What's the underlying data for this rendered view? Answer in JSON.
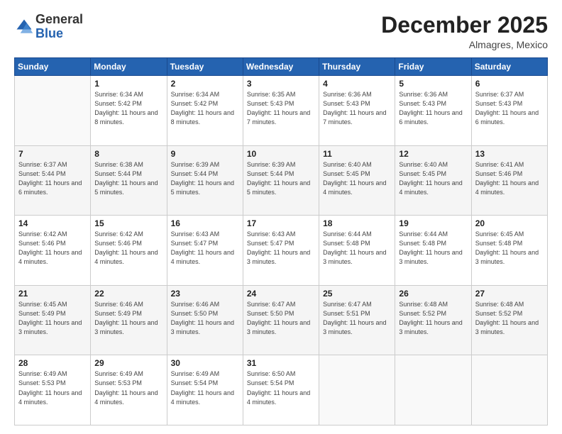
{
  "header": {
    "logo_general": "General",
    "logo_blue": "Blue",
    "month": "December 2025",
    "location": "Almagres, Mexico"
  },
  "days_of_week": [
    "Sunday",
    "Monday",
    "Tuesday",
    "Wednesday",
    "Thursday",
    "Friday",
    "Saturday"
  ],
  "weeks": [
    [
      {
        "day": "",
        "sunrise": "",
        "sunset": "",
        "daylight": ""
      },
      {
        "day": "1",
        "sunrise": "Sunrise: 6:34 AM",
        "sunset": "Sunset: 5:42 PM",
        "daylight": "Daylight: 11 hours and 8 minutes."
      },
      {
        "day": "2",
        "sunrise": "Sunrise: 6:34 AM",
        "sunset": "Sunset: 5:42 PM",
        "daylight": "Daylight: 11 hours and 8 minutes."
      },
      {
        "day": "3",
        "sunrise": "Sunrise: 6:35 AM",
        "sunset": "Sunset: 5:43 PM",
        "daylight": "Daylight: 11 hours and 7 minutes."
      },
      {
        "day": "4",
        "sunrise": "Sunrise: 6:36 AM",
        "sunset": "Sunset: 5:43 PM",
        "daylight": "Daylight: 11 hours and 7 minutes."
      },
      {
        "day": "5",
        "sunrise": "Sunrise: 6:36 AM",
        "sunset": "Sunset: 5:43 PM",
        "daylight": "Daylight: 11 hours and 6 minutes."
      },
      {
        "day": "6",
        "sunrise": "Sunrise: 6:37 AM",
        "sunset": "Sunset: 5:43 PM",
        "daylight": "Daylight: 11 hours and 6 minutes."
      }
    ],
    [
      {
        "day": "7",
        "sunrise": "Sunrise: 6:37 AM",
        "sunset": "Sunset: 5:44 PM",
        "daylight": "Daylight: 11 hours and 6 minutes."
      },
      {
        "day": "8",
        "sunrise": "Sunrise: 6:38 AM",
        "sunset": "Sunset: 5:44 PM",
        "daylight": "Daylight: 11 hours and 5 minutes."
      },
      {
        "day": "9",
        "sunrise": "Sunrise: 6:39 AM",
        "sunset": "Sunset: 5:44 PM",
        "daylight": "Daylight: 11 hours and 5 minutes."
      },
      {
        "day": "10",
        "sunrise": "Sunrise: 6:39 AM",
        "sunset": "Sunset: 5:44 PM",
        "daylight": "Daylight: 11 hours and 5 minutes."
      },
      {
        "day": "11",
        "sunrise": "Sunrise: 6:40 AM",
        "sunset": "Sunset: 5:45 PM",
        "daylight": "Daylight: 11 hours and 4 minutes."
      },
      {
        "day": "12",
        "sunrise": "Sunrise: 6:40 AM",
        "sunset": "Sunset: 5:45 PM",
        "daylight": "Daylight: 11 hours and 4 minutes."
      },
      {
        "day": "13",
        "sunrise": "Sunrise: 6:41 AM",
        "sunset": "Sunset: 5:46 PM",
        "daylight": "Daylight: 11 hours and 4 minutes."
      }
    ],
    [
      {
        "day": "14",
        "sunrise": "Sunrise: 6:42 AM",
        "sunset": "Sunset: 5:46 PM",
        "daylight": "Daylight: 11 hours and 4 minutes."
      },
      {
        "day": "15",
        "sunrise": "Sunrise: 6:42 AM",
        "sunset": "Sunset: 5:46 PM",
        "daylight": "Daylight: 11 hours and 4 minutes."
      },
      {
        "day": "16",
        "sunrise": "Sunrise: 6:43 AM",
        "sunset": "Sunset: 5:47 PM",
        "daylight": "Daylight: 11 hours and 4 minutes."
      },
      {
        "day": "17",
        "sunrise": "Sunrise: 6:43 AM",
        "sunset": "Sunset: 5:47 PM",
        "daylight": "Daylight: 11 hours and 3 minutes."
      },
      {
        "day": "18",
        "sunrise": "Sunrise: 6:44 AM",
        "sunset": "Sunset: 5:48 PM",
        "daylight": "Daylight: 11 hours and 3 minutes."
      },
      {
        "day": "19",
        "sunrise": "Sunrise: 6:44 AM",
        "sunset": "Sunset: 5:48 PM",
        "daylight": "Daylight: 11 hours and 3 minutes."
      },
      {
        "day": "20",
        "sunrise": "Sunrise: 6:45 AM",
        "sunset": "Sunset: 5:48 PM",
        "daylight": "Daylight: 11 hours and 3 minutes."
      }
    ],
    [
      {
        "day": "21",
        "sunrise": "Sunrise: 6:45 AM",
        "sunset": "Sunset: 5:49 PM",
        "daylight": "Daylight: 11 hours and 3 minutes."
      },
      {
        "day": "22",
        "sunrise": "Sunrise: 6:46 AM",
        "sunset": "Sunset: 5:49 PM",
        "daylight": "Daylight: 11 hours and 3 minutes."
      },
      {
        "day": "23",
        "sunrise": "Sunrise: 6:46 AM",
        "sunset": "Sunset: 5:50 PM",
        "daylight": "Daylight: 11 hours and 3 minutes."
      },
      {
        "day": "24",
        "sunrise": "Sunrise: 6:47 AM",
        "sunset": "Sunset: 5:50 PM",
        "daylight": "Daylight: 11 hours and 3 minutes."
      },
      {
        "day": "25",
        "sunrise": "Sunrise: 6:47 AM",
        "sunset": "Sunset: 5:51 PM",
        "daylight": "Daylight: 11 hours and 3 minutes."
      },
      {
        "day": "26",
        "sunrise": "Sunrise: 6:48 AM",
        "sunset": "Sunset: 5:52 PM",
        "daylight": "Daylight: 11 hours and 3 minutes."
      },
      {
        "day": "27",
        "sunrise": "Sunrise: 6:48 AM",
        "sunset": "Sunset: 5:52 PM",
        "daylight": "Daylight: 11 hours and 3 minutes."
      }
    ],
    [
      {
        "day": "28",
        "sunrise": "Sunrise: 6:49 AM",
        "sunset": "Sunset: 5:53 PM",
        "daylight": "Daylight: 11 hours and 4 minutes."
      },
      {
        "day": "29",
        "sunrise": "Sunrise: 6:49 AM",
        "sunset": "Sunset: 5:53 PM",
        "daylight": "Daylight: 11 hours and 4 minutes."
      },
      {
        "day": "30",
        "sunrise": "Sunrise: 6:49 AM",
        "sunset": "Sunset: 5:54 PM",
        "daylight": "Daylight: 11 hours and 4 minutes."
      },
      {
        "day": "31",
        "sunrise": "Sunrise: 6:50 AM",
        "sunset": "Sunset: 5:54 PM",
        "daylight": "Daylight: 11 hours and 4 minutes."
      },
      {
        "day": "",
        "sunrise": "",
        "sunset": "",
        "daylight": ""
      },
      {
        "day": "",
        "sunrise": "",
        "sunset": "",
        "daylight": ""
      },
      {
        "day": "",
        "sunrise": "",
        "sunset": "",
        "daylight": ""
      }
    ]
  ]
}
